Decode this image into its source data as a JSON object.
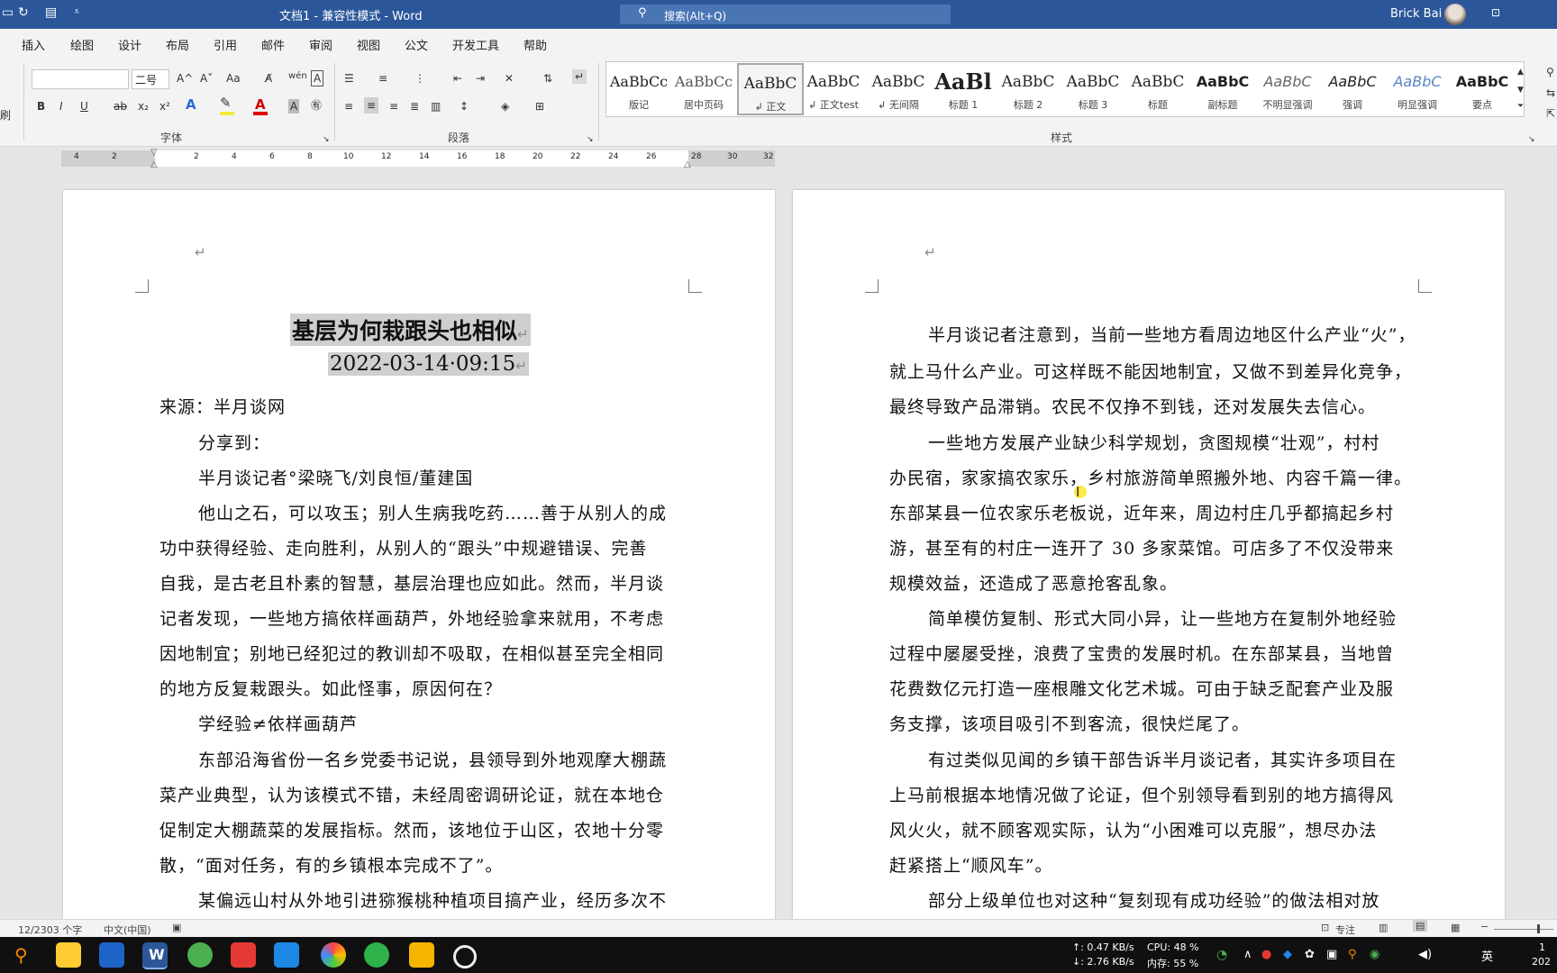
{
  "titlebar": {
    "doc_title": "文档1  -  兼容性模式  -  Word",
    "search_placeholder": "搜索(Alt+Q)",
    "user": "Brick Bai"
  },
  "menu_tabs": [
    "插入",
    "绘图",
    "设计",
    "布局",
    "引用",
    "邮件",
    "审阅",
    "视图",
    "公文",
    "开发工具",
    "帮助"
  ],
  "ribbon": {
    "font_size": "二号",
    "font_grow": "A^",
    "font_shrink": "A˅",
    "change_case": "Aa",
    "bold": "B",
    "italic": "I",
    "underline": "U",
    "strike": "ab",
    "subscript": "x₂",
    "superscript": "x²",
    "font_group": "字体",
    "para_group": "段落",
    "styles_group": "样式",
    "left_edge": "刷"
  },
  "styles": [
    {
      "preview": "AaBbCc",
      "name": "版记"
    },
    {
      "preview": "AaBbCc",
      "name": "居中页码"
    },
    {
      "preview": "AaBbC",
      "name": "↲ 正文"
    },
    {
      "preview": "AaBbC",
      "name": "↲ 正文test"
    },
    {
      "preview": "AaBbC",
      "name": "↲ 无间隔"
    },
    {
      "preview": "AaBl",
      "name": "标题 1"
    },
    {
      "preview": "AaBbC",
      "name": "标题 2"
    },
    {
      "preview": "AaBbC",
      "name": "标题 3"
    },
    {
      "preview": "AaBbC",
      "name": "标题"
    },
    {
      "preview": "AaBbC",
      "name": "副标题"
    },
    {
      "preview": "AaBbC",
      "name": "不明显强调"
    },
    {
      "preview": "AaBbC",
      "name": "强调"
    },
    {
      "preview": "AaBbC",
      "name": "明显强调"
    },
    {
      "preview": "AaBbC",
      "name": "要点"
    }
  ],
  "ruler_labels": [
    "4",
    "2",
    "",
    "2",
    "4",
    "6",
    "8",
    "10",
    "12",
    "14",
    "16",
    "18",
    "20",
    "22",
    "24",
    "26",
    "28",
    "30",
    "32"
  ],
  "page_left": {
    "title": "基层为何栽跟头也相似",
    "datetime": "2022-03-14·09:15",
    "lines": [
      "来源：半月谈网",
      "分享到：",
      "半月谈记者°梁晓飞/刘良恒/董建国",
      "他山之石，可以攻玉；别人生病我吃药……善于从别人的成",
      "功中获得经验、走向胜利，从别人的“跟头”中规避错误、完善",
      "自我，是古老且朴素的智慧，基层治理也应如此。然而，半月谈",
      "记者发现，一些地方搞依样画葫芦，外地经验拿来就用，不考虑",
      "因地制宜；别地已经犯过的教训却不吸取，在相似甚至完全相同",
      "的地方反复栽跟头。如此怪事，原因何在？",
      "学经验≠依样画葫芦",
      "东部沿海省份一名乡党委书记说，县领导到外地观摩大棚蔬",
      "菜产业典型，认为该模式不错，未经周密调研论证，就在本地仓",
      "促制定大棚蔬菜的发展指标。然而，该地位于山区，农地十分零",
      "散，“面对任务，有的乡镇根本完成不了”。",
      "某偏远山村从外地引进猕猴桃种植项目搞产业，经历多次不"
    ]
  },
  "page_right": {
    "lines": [
      "半月谈记者注意到，当前一些地方看周边地区什么产业“火”，",
      "就上马什么产业。可这样既不能因地制宜，又做不到差异化竞争，",
      "最终导致产品滞销。农民不仅挣不到钱，还对发展失去信心。",
      "一些地方发展产业缺少科学规划，贪图规模“壮观”，村村",
      "办民宿，家家搞农家乐，乡村旅游简单照搬外地、内容千篇一律。",
      "东部某县一位农家乐老板说，近年来，周边村庄几乎都搞起乡村",
      "游，甚至有的村庄一连开了 30 多家菜馆。可店多了不仅没带来",
      "规模效益，还造成了恶意抢客乱象。",
      "简单模仿复制、形式大同小异，让一些地方在复制外地经验",
      "过程中屡屡受挫，浪费了宝贵的发展时机。在东部某县，当地曾",
      "花费数亿元打造一座根雕文化艺术城。可由于缺乏配套产业及服",
      "务支撑，该项目吸引不到客流，很快烂尾了。",
      "有过类似见闻的乡镇干部告诉半月谈记者，其实许多项目在",
      "上马前根据本地情况做了论证，但个别领导看到别的地方搞得风",
      "风火火，就不顾客观实际，认为“小困难可以克服”，想尽办法",
      "赶紧搭上“顺风车”。",
      "部分上级单位也对这种“复刻现有成功经验”的做法相对放"
    ]
  },
  "statusbar": {
    "words": "12/2303 个字",
    "language": "中文(中国)",
    "focus": "专注"
  },
  "taskbar": {
    "net_up": "↑: 0.47 KB/s",
    "net_down": "↓: 2.76 KB/s",
    "cpu": "CPU: 48 %",
    "mem": "内存: 55 %",
    "ime": "英",
    "clock_top": "1",
    "clock_bottom": "202"
  }
}
